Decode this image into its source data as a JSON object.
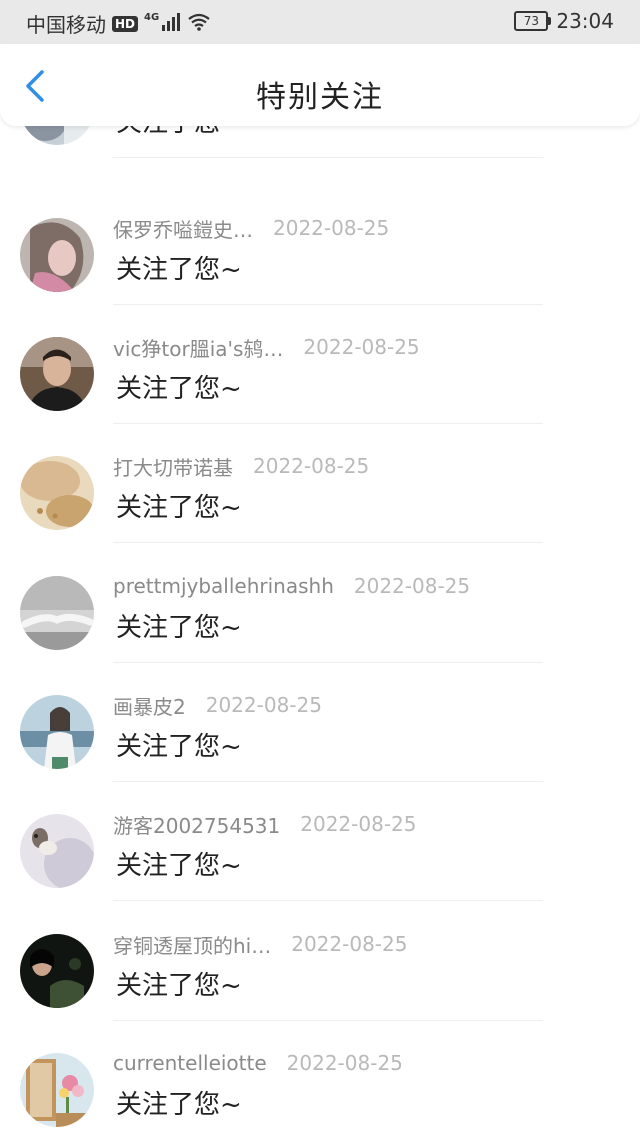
{
  "status_bar": {
    "carrier": "中国移动",
    "hd": "HD",
    "network": "4G",
    "battery": "73",
    "time": "23:04"
  },
  "header": {
    "title": "特别关注"
  },
  "list": [
    {
      "name": "",
      "date": "",
      "message": "关注了您~"
    },
    {
      "name": "保罗乔嗌鎧史…",
      "date": "2022-08-25",
      "message": "关注了您~"
    },
    {
      "name": "vic狰tor膃ia's鸫…",
      "date": "2022-08-25",
      "message": "关注了您~"
    },
    {
      "name": "打大切带诺基",
      "date": "2022-08-25",
      "message": "关注了您~"
    },
    {
      "name": "prettmjyballehrinashh",
      "date": "2022-08-25",
      "message": "关注了您~"
    },
    {
      "name": "画暴皮2",
      "date": "2022-08-25",
      "message": "关注了您~"
    },
    {
      "name": "游客2002754531",
      "date": "2022-08-25",
      "message": "关注了您~"
    },
    {
      "name": "穿铜透屋顶的hi…",
      "date": "2022-08-25",
      "message": "关注了您~"
    },
    {
      "name": "currentelleiotte",
      "date": "2022-08-25",
      "message": "关注了您~"
    }
  ],
  "colors": {
    "accent": "#2f8fe6",
    "status_bar_bg": "#e9e9ea",
    "name_text": "#8a8a8a",
    "date_text": "#b9b9b9",
    "message_text": "#222222"
  }
}
